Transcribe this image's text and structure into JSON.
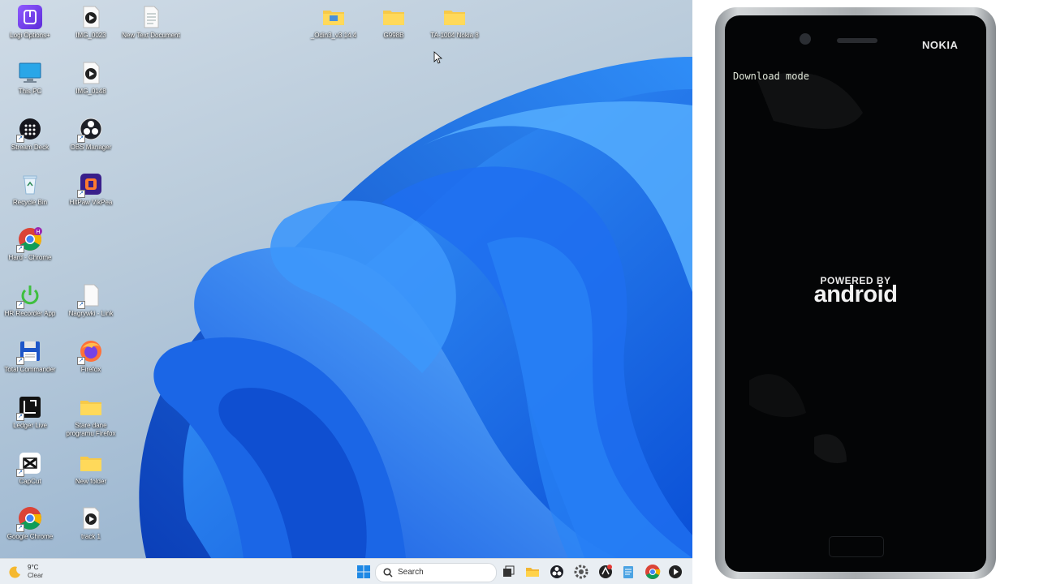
{
  "desktop": {
    "icons": [
      {
        "label": "Logi Options+",
        "icon": "logi-icon"
      },
      {
        "label": "IMG_0023",
        "icon": "video-file-icon"
      },
      {
        "label": "New Text Document",
        "icon": "text-file-icon"
      },
      {
        "label": "_Odin3_v3.14.4",
        "icon": "folder-icon"
      },
      {
        "label": "G998B",
        "icon": "folder-icon"
      },
      {
        "label": "TA-1004 Nokia 8",
        "icon": "folder-icon"
      },
      {
        "label": "This PC",
        "icon": "monitor-icon"
      },
      {
        "label": "IMG_0148",
        "icon": "video-file-icon"
      },
      {
        "label": "Stream Deck",
        "icon": "stream-deck-icon"
      },
      {
        "label": "OBS Manager",
        "icon": "obs-icon"
      },
      {
        "label": "Recycle Bin",
        "icon": "recycle-bin-icon"
      },
      {
        "label": "HitPaw VikPea",
        "icon": "hitpaw-icon"
      },
      {
        "label": "Hard - Chrome",
        "icon": "chrome-icon"
      },
      {
        "label": "HR Recorder App",
        "icon": "power-icon"
      },
      {
        "label": "Nagrywki - Link",
        "icon": "blank-file-icon"
      },
      {
        "label": "Total Commander",
        "icon": "floppy-icon"
      },
      {
        "label": "Firefox",
        "icon": "firefox-icon"
      },
      {
        "label": "Ledger Live",
        "icon": "ledger-icon"
      },
      {
        "label": "Stare dane programu Firefox",
        "icon": "folder-icon"
      },
      {
        "label": "CapCut",
        "icon": "capcut-icon"
      },
      {
        "label": "New folder",
        "icon": "folder-icon"
      },
      {
        "label": "Google Chrome",
        "icon": "chrome-icon"
      },
      {
        "label": "track 1",
        "icon": "video-file-icon"
      }
    ]
  },
  "taskbar": {
    "weather": {
      "temp": "9°C",
      "condition": "Clear",
      "icon": "moon-icon"
    },
    "search_placeholder": "Search",
    "pinned": [
      "start-icon",
      "task-view-icon",
      "file-explorer-icon",
      "obs-icon",
      "settings-icon",
      "app-icon",
      "notepad-icon",
      "chrome-icon",
      "media-player-icon"
    ]
  },
  "phone": {
    "brand": "NOKIA",
    "mode_text": "Download mode",
    "powered_by": "POWERED BY",
    "android": "android"
  },
  "colors": {
    "wallpaper_blue": "#1e74e8",
    "phone_screen": "#040506",
    "taskbar": "#e9eef3"
  }
}
